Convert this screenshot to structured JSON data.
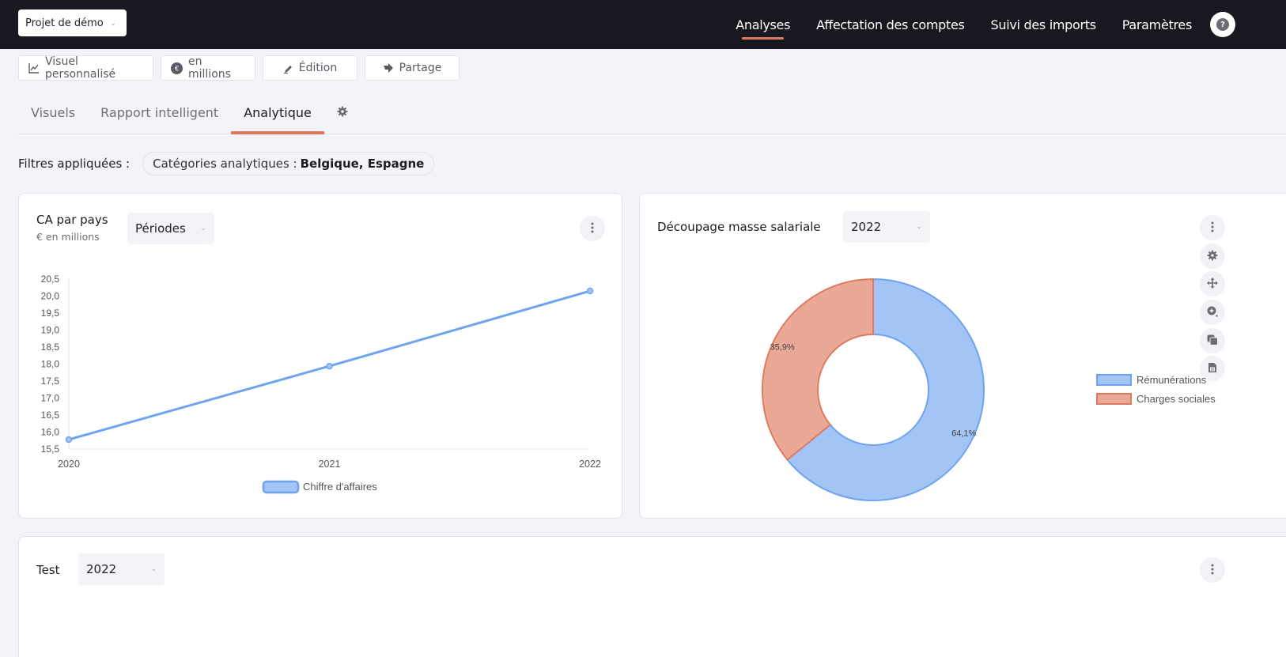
{
  "topbar": {
    "project": "Projet de démo",
    "nav": [
      {
        "label": "Analyses",
        "active": true
      },
      {
        "label": "Affectation des comptes",
        "active": false
      },
      {
        "label": "Suivi des imports",
        "active": false
      },
      {
        "label": "Paramètres",
        "active": false
      }
    ],
    "help_icon": "?"
  },
  "toolbar": {
    "visual_label": "Visuel personnalisé",
    "currency_label": "en millions",
    "edit_label": "Édition",
    "share_label": "Partage"
  },
  "tabs": [
    {
      "label": "Visuels",
      "active": false
    },
    {
      "label": "Rapport intelligent",
      "active": false
    },
    {
      "label": "Analytique",
      "active": true
    }
  ],
  "filters": {
    "label": "Filtres appliquées :",
    "chip_key": "Catégories analytiques :",
    "chip_value": "Belgique, Espagne"
  },
  "cards": {
    "ca": {
      "title": "CA par pays",
      "subtitle": "€ en millions",
      "select": "Périodes"
    },
    "masse": {
      "title": "Découpage masse salariale",
      "select": "2022"
    },
    "test": {
      "title": "Test",
      "select": "2022"
    }
  },
  "colors": {
    "accent": "#e07a5f",
    "series_blue": "#6fa3ef",
    "series_blue_fill": "#a3c5f5",
    "series_red": "#e07a5f",
    "series_red_fill": "#eaa997"
  },
  "chart_data": [
    {
      "type": "line",
      "title": "CA par pays",
      "x": [
        "2020",
        "2021",
        "2022"
      ],
      "series": [
        {
          "name": "Chiffre d'affaires",
          "values": [
            15.78,
            17.94,
            20.15
          ]
        }
      ],
      "ylim": [
        15.5,
        20.5
      ],
      "yticks": [
        "20,5",
        "20,0",
        "19,5",
        "19,0",
        "18,5",
        "18,0",
        "17,5",
        "17,0",
        "16,5",
        "16,0",
        "15,5"
      ],
      "ytick_values": [
        20.5,
        20.0,
        19.5,
        19.0,
        18.5,
        18.0,
        17.5,
        17.0,
        16.5,
        16.0,
        15.5
      ],
      "legend": "bottom",
      "grid": false
    },
    {
      "type": "pie",
      "title": "Découpage masse salariale",
      "categories": [
        "Rémunérations",
        "Charges sociales"
      ],
      "values": [
        64.1,
        35.9
      ],
      "labels": [
        "64,1%",
        "35,9%"
      ],
      "legend": "right"
    }
  ]
}
